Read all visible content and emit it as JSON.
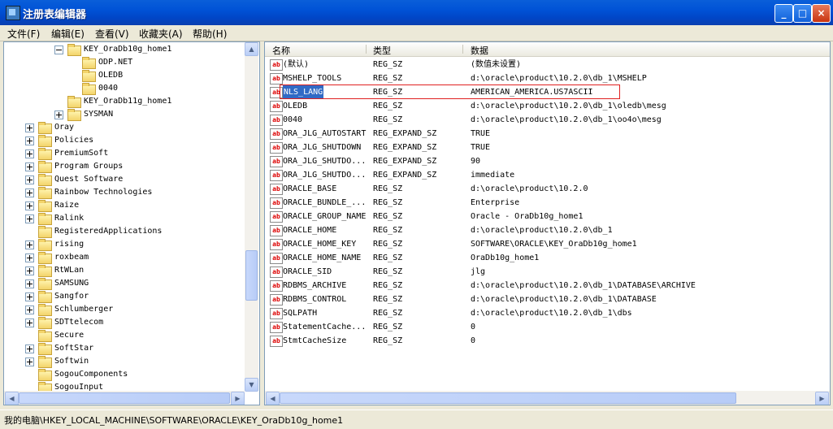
{
  "window": {
    "title": "注册表编辑器",
    "minimize": "_",
    "maximize": "□",
    "close": "×"
  },
  "menu": [
    "文件(F)",
    "编辑(E)",
    "查看(V)",
    "收藏夹(A)",
    "帮助(H)"
  ],
  "tree": [
    {
      "label": "KEY_OraDb10g_home1",
      "expander": "minus",
      "indent": 2
    },
    {
      "label": "ODP.NET",
      "expander": "none",
      "indent": 3
    },
    {
      "label": "OLEDB",
      "expander": "none",
      "indent": 3
    },
    {
      "label": "0040",
      "expander": "none",
      "indent": 3
    },
    {
      "label": "KEY_OraDb11g_home1",
      "expander": "none",
      "indent": 2
    },
    {
      "label": "SYSMAN",
      "expander": "plus",
      "indent": 2
    },
    {
      "label": "Oray",
      "expander": "plus",
      "indent": 0
    },
    {
      "label": "Policies",
      "expander": "plus",
      "indent": 0
    },
    {
      "label": "PremiumSoft",
      "expander": "plus",
      "indent": 0
    },
    {
      "label": "Program Groups",
      "expander": "plus",
      "indent": 0
    },
    {
      "label": "Quest Software",
      "expander": "plus",
      "indent": 0
    },
    {
      "label": "Rainbow Technologies",
      "expander": "plus",
      "indent": 0
    },
    {
      "label": "Raize",
      "expander": "plus",
      "indent": 0
    },
    {
      "label": "Ralink",
      "expander": "plus",
      "indent": 0
    },
    {
      "label": "RegisteredApplications",
      "expander": "none",
      "indent": 0
    },
    {
      "label": "rising",
      "expander": "plus",
      "indent": 0
    },
    {
      "label": "roxbeam",
      "expander": "plus",
      "indent": 0
    },
    {
      "label": "RtWLan",
      "expander": "plus",
      "indent": 0
    },
    {
      "label": "SAMSUNG",
      "expander": "plus",
      "indent": 0
    },
    {
      "label": "Sangfor",
      "expander": "plus",
      "indent": 0
    },
    {
      "label": "Schlumberger",
      "expander": "plus",
      "indent": 0
    },
    {
      "label": "SDTtelecom",
      "expander": "plus",
      "indent": 0
    },
    {
      "label": "Secure",
      "expander": "none",
      "indent": 0
    },
    {
      "label": "SoftStar",
      "expander": "plus",
      "indent": 0
    },
    {
      "label": "Softwin",
      "expander": "plus",
      "indent": 0
    },
    {
      "label": "SogouComponents",
      "expander": "none",
      "indent": 0
    },
    {
      "label": "SogouInput",
      "expander": "none",
      "indent": 0
    }
  ],
  "columns": {
    "name": "名称",
    "type": "类型",
    "data": "数据"
  },
  "values": [
    {
      "name": "(默认)",
      "type": "REG_SZ",
      "data": "(数值未设置)"
    },
    {
      "name": "MSHELP_TOOLS",
      "type": "REG_SZ",
      "data": "d:\\oracle\\product\\10.2.0\\db_1\\MSHELP"
    },
    {
      "name": "NLS_LANG",
      "type": "REG_SZ",
      "data": "AMERICAN_AMERICA.US7ASCII",
      "selected": true
    },
    {
      "name": "OLEDB",
      "type": "REG_SZ",
      "data": "d:\\oracle\\product\\10.2.0\\db_1\\oledb\\mesg"
    },
    {
      "name": "0040",
      "type": "REG_SZ",
      "data": "d:\\oracle\\product\\10.2.0\\db_1\\oo4o\\mesg"
    },
    {
      "name": "ORA_JLG_AUTOSTART",
      "type": "REG_EXPAND_SZ",
      "data": "TRUE"
    },
    {
      "name": "ORA_JLG_SHUTDOWN",
      "type": "REG_EXPAND_SZ",
      "data": "TRUE"
    },
    {
      "name": "ORA_JLG_SHUTDO...",
      "type": "REG_EXPAND_SZ",
      "data": "90"
    },
    {
      "name": "ORA_JLG_SHUTDO...",
      "type": "REG_EXPAND_SZ",
      "data": "immediate"
    },
    {
      "name": "ORACLE_BASE",
      "type": "REG_SZ",
      "data": "d:\\oracle\\product\\10.2.0"
    },
    {
      "name": "ORACLE_BUNDLE_...",
      "type": "REG_SZ",
      "data": "Enterprise"
    },
    {
      "name": "ORACLE_GROUP_NAME",
      "type": "REG_SZ",
      "data": "Oracle - OraDb10g_home1"
    },
    {
      "name": "ORACLE_HOME",
      "type": "REG_SZ",
      "data": "d:\\oracle\\product\\10.2.0\\db_1"
    },
    {
      "name": "ORACLE_HOME_KEY",
      "type": "REG_SZ",
      "data": "SOFTWARE\\ORACLE\\KEY_OraDb10g_home1"
    },
    {
      "name": "ORACLE_HOME_NAME",
      "type": "REG_SZ",
      "data": "OraDb10g_home1"
    },
    {
      "name": "ORACLE_SID",
      "type": "REG_SZ",
      "data": "jlg"
    },
    {
      "name": "RDBMS_ARCHIVE",
      "type": "REG_SZ",
      "data": "d:\\oracle\\product\\10.2.0\\db_1\\DATABASE\\ARCHIVE"
    },
    {
      "name": "RDBMS_CONTROL",
      "type": "REG_SZ",
      "data": "d:\\oracle\\product\\10.2.0\\db_1\\DATABASE"
    },
    {
      "name": "SQLPATH",
      "type": "REG_SZ",
      "data": "d:\\oracle\\product\\10.2.0\\db_1\\dbs"
    },
    {
      "name": "StatementCache...",
      "type": "REG_SZ",
      "data": "0"
    },
    {
      "name": "StmtCacheSize",
      "type": "REG_SZ",
      "data": "0"
    }
  ],
  "value_icon": "ab",
  "status": "我的电脑\\HKEY_LOCAL_MACHINE\\SOFTWARE\\ORACLE\\KEY_OraDb10g_home1",
  "scroll_glyphs": {
    "up": "▲",
    "down": "▼",
    "left": "◀",
    "right": "▶",
    "grip": "⋮⋮"
  }
}
